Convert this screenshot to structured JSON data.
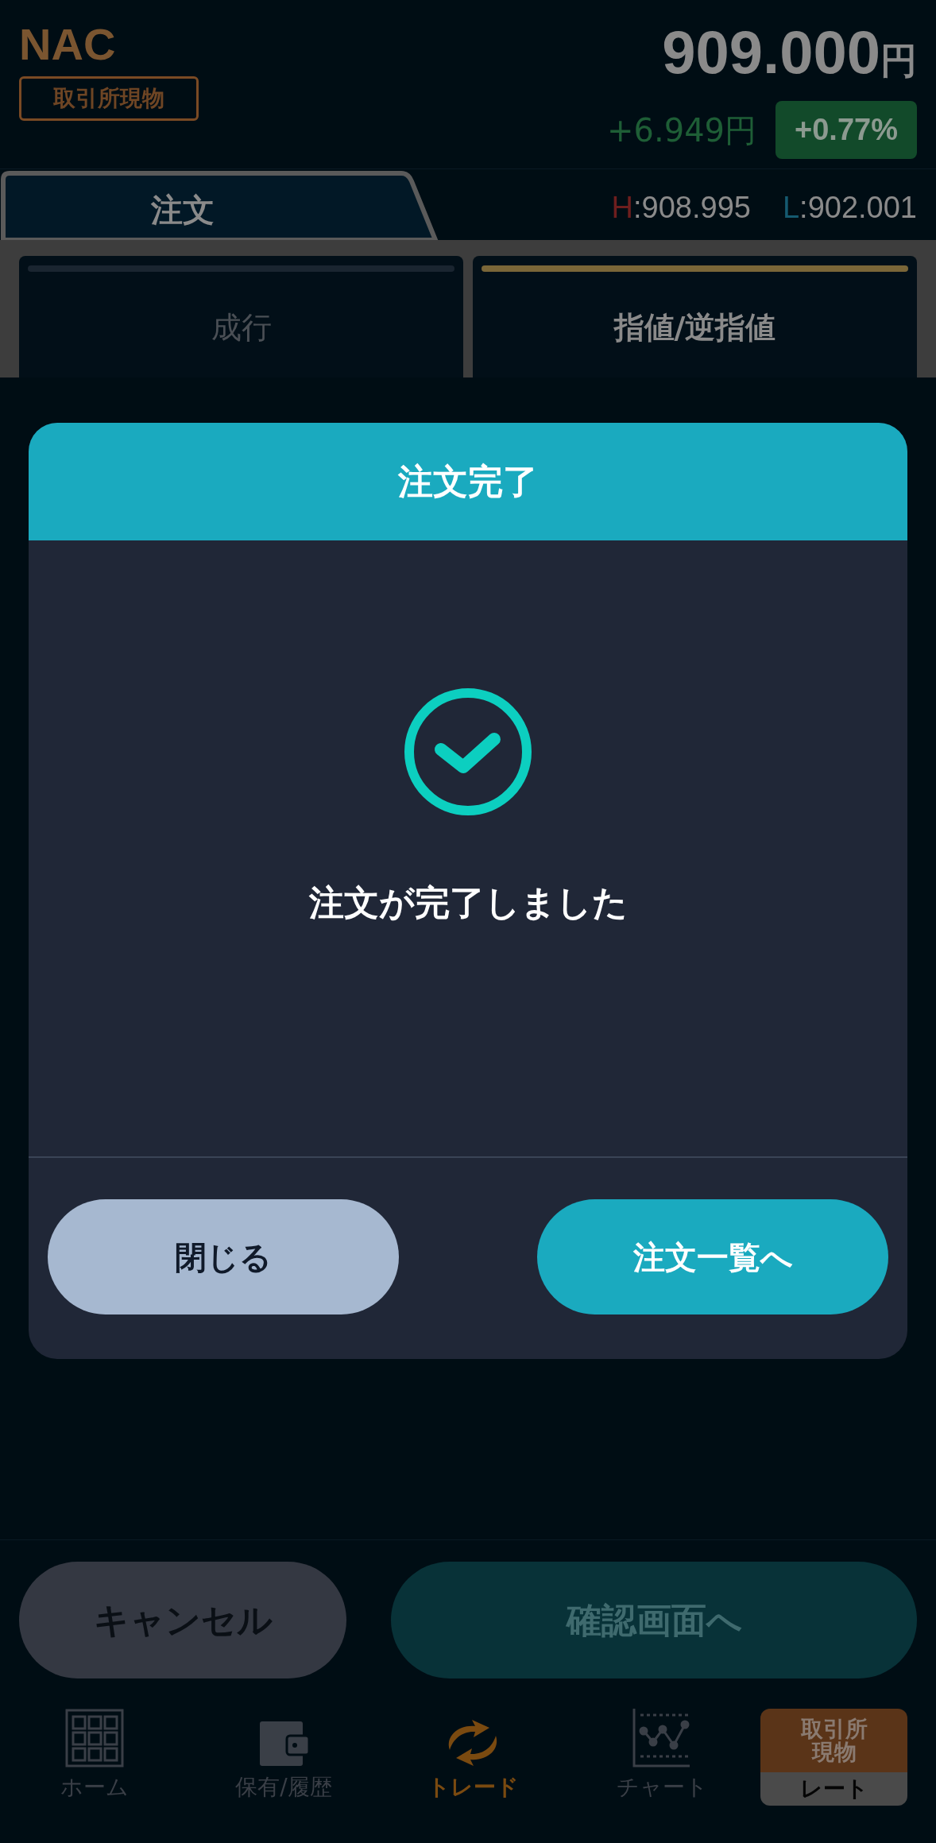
{
  "header": {
    "symbol": "NAC",
    "market_badge": "取引所現物",
    "price": "909.000",
    "price_unit": "円",
    "change": "+6.949円",
    "change_percent": "+0.77%"
  },
  "tab": {
    "label": "注文"
  },
  "high_low": [
    {
      "kind": "high",
      "letter": "H",
      "value": ":908.995"
    },
    {
      "kind": "low",
      "letter": "L",
      "value": ":902.001"
    }
  ],
  "order_types": [
    {
      "label": "成行",
      "selected": false
    },
    {
      "label": "指値/逆指値",
      "selected": true
    }
  ],
  "dialog": {
    "title": "注文完了",
    "message": "注文が完了しました",
    "buttons": [
      {
        "kind": "secondary",
        "label": "閉じる"
      },
      {
        "kind": "primary",
        "label": "注文一覧へ"
      }
    ]
  },
  "actions": [
    {
      "kind": "secondary",
      "label": "キャンセル"
    },
    {
      "kind": "primary",
      "label": "確認画面へ"
    }
  ],
  "nav": [
    {
      "kind": "home",
      "label": "ホーム",
      "selected": false
    },
    {
      "kind": "wallet",
      "label": "保有/履歴",
      "selected": false
    },
    {
      "kind": "trade",
      "label": "トレード",
      "selected": true
    },
    {
      "kind": "chart",
      "label": "チャート",
      "selected": false
    }
  ],
  "rate_badge": {
    "top": "取引所現物",
    "bottom": "レート"
  }
}
